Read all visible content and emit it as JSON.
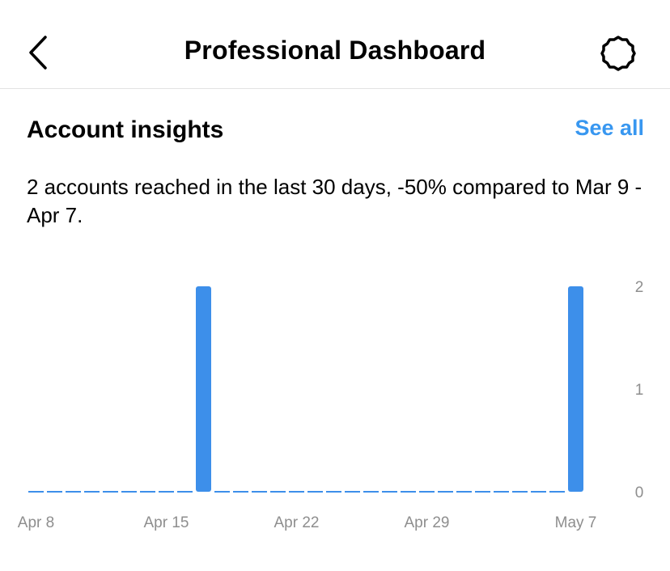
{
  "header": {
    "title": "Professional Dashboard",
    "back_icon": "chevron-left-icon",
    "settings_icon": "gear-icon"
  },
  "insights": {
    "title": "Account insights",
    "see_all": "See all",
    "summary": "2 accounts reached in the last 30 days, -50% compared to Mar 9 - Apr 7."
  },
  "colors": {
    "accent": "#3897f0",
    "bar": "#3d8fea",
    "axis_text": "#8e8e8e"
  },
  "chart_data": {
    "type": "bar",
    "categories": [
      "Apr 8",
      "Apr 9",
      "Apr 10",
      "Apr 11",
      "Apr 12",
      "Apr 13",
      "Apr 14",
      "Apr 15",
      "Apr 16",
      "Apr 17",
      "Apr 18",
      "Apr 19",
      "Apr 20",
      "Apr 21",
      "Apr 22",
      "Apr 23",
      "Apr 24",
      "Apr 25",
      "Apr 26",
      "Apr 27",
      "Apr 28",
      "Apr 29",
      "Apr 30",
      "May 1",
      "May 2",
      "May 3",
      "May 4",
      "May 5",
      "May 6",
      "May 7"
    ],
    "values": [
      0,
      0,
      0,
      0,
      0,
      0,
      0,
      0,
      0,
      2,
      0,
      0,
      0,
      0,
      0,
      0,
      0,
      0,
      0,
      0,
      0,
      0,
      0,
      0,
      0,
      0,
      0,
      0,
      0,
      2
    ],
    "x_tick_labels": [
      {
        "category": "Apr 8",
        "text": "Apr 8"
      },
      {
        "category": "Apr 15",
        "text": "Apr 15"
      },
      {
        "category": "Apr 22",
        "text": "Apr 22"
      },
      {
        "category": "Apr 29",
        "text": "Apr 29"
      },
      {
        "category": "May 7",
        "text": "May 7"
      }
    ],
    "y_ticks": [
      0,
      1,
      2
    ],
    "ylim": [
      0,
      2
    ],
    "y_axis_position": "right",
    "zero_values_shown_as": "dashed baseline",
    "grid": false
  }
}
